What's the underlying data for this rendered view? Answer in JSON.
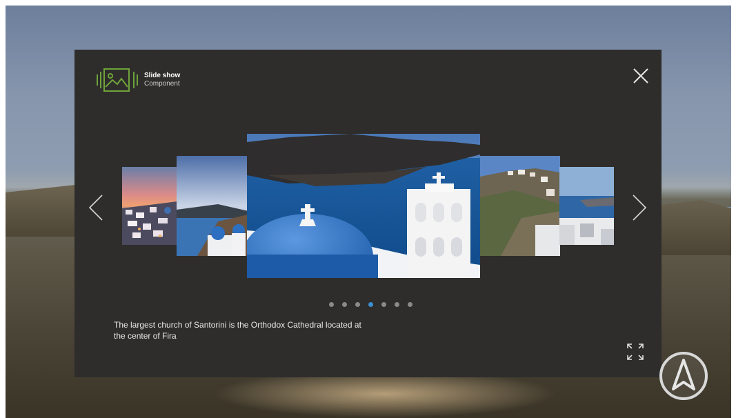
{
  "window": {
    "title": "Slide show",
    "subtitle": "Component"
  },
  "icons": {
    "logo": "slideshow-logo-icon",
    "close": "close-icon",
    "prev": "chevron-left-icon",
    "next": "chevron-right-icon",
    "fullscreen": "fullscreen-icon",
    "compass": "navigation-compass-icon"
  },
  "slideshow": {
    "slides": [
      {
        "subject": "Oia village at sunset"
      },
      {
        "subject": "Blue domes above the caldera"
      },
      {
        "subject": "Blue dome church with white bell tower over the caldera"
      },
      {
        "subject": "Fira cliffside town"
      },
      {
        "subject": "Terrace overlooking the caldera"
      }
    ],
    "dot_count": 7,
    "active_dot": 4,
    "caption": "The largest church of Santorini is the Orthodox Cathedral located at the center of Fira"
  },
  "colors": {
    "panel": "#2e2d2c",
    "logo_accent": "#6fa33a",
    "active_dot": "#3b8fd1",
    "dot": "#8a8a8a"
  }
}
